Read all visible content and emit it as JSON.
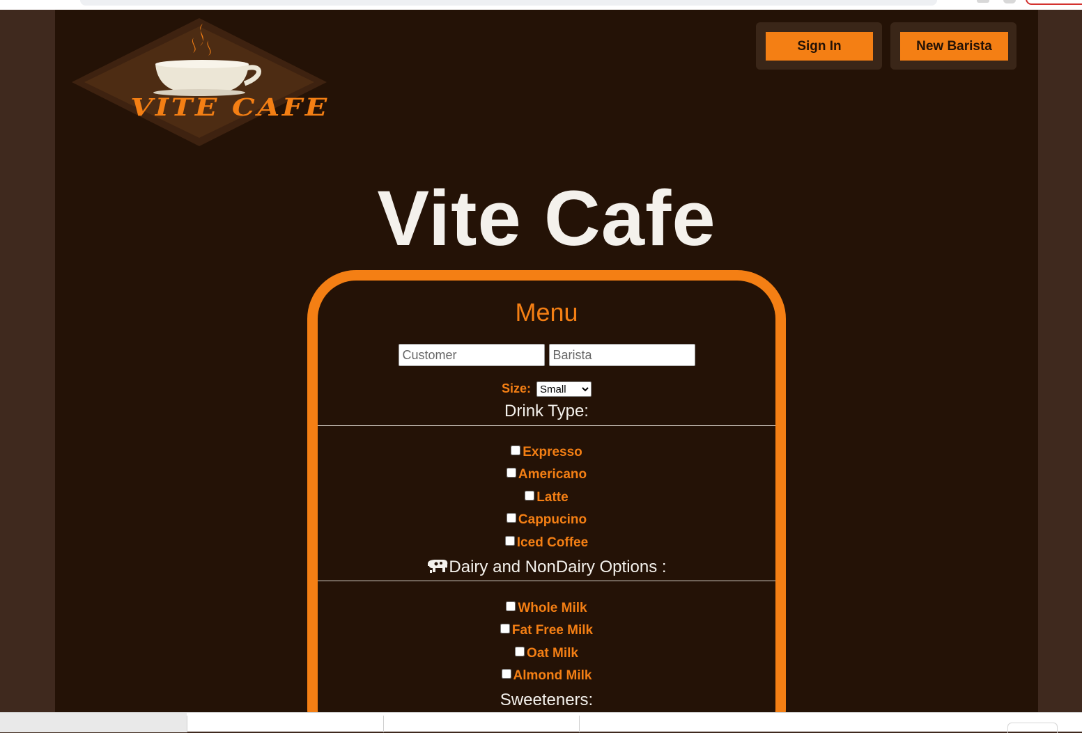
{
  "header": {
    "logo_text": "VITE CAFE",
    "sign_in_label": "Sign In",
    "new_barista_label": "New Barista"
  },
  "title": "Vite Cafe",
  "menu": {
    "title": "Menu",
    "customer_placeholder": "Customer",
    "barista_placeholder": "Barista",
    "size_label": "Size:",
    "size_selected": "Small",
    "drink_type_title": "Drink Type:",
    "drinks": [
      {
        "label": "Expresso"
      },
      {
        "label": "Americano"
      },
      {
        "label": "Latte"
      },
      {
        "label": "Cappucino"
      },
      {
        "label": "Iced Coffee"
      }
    ],
    "dairy_title": "Dairy and NonDairy Options :",
    "dairy_icon": "cow-icon",
    "dairy_options": [
      {
        "label": "Whole Milk"
      },
      {
        "label": "Fat Free Milk"
      },
      {
        "label": "Oat Milk"
      },
      {
        "label": "Almond Milk"
      }
    ],
    "sweeteners_title": "Sweeteners:"
  },
  "colors": {
    "accent": "#f47f14",
    "page_background": "#241206",
    "outer_background": "#3f291e",
    "title_text": "#f4f1ec"
  }
}
